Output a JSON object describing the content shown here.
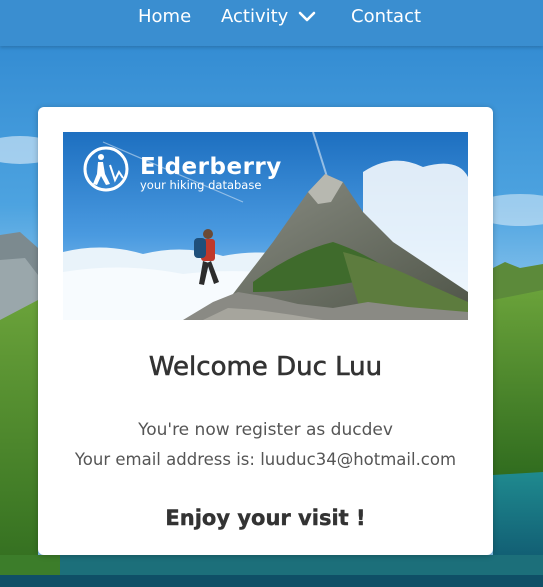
{
  "nav": {
    "home_label": "Home",
    "activity_label": "Activity",
    "contact_label": "Contact"
  },
  "card": {
    "logo": {
      "title": "Elderberry",
      "tagline": "your hiking database"
    },
    "welcome": "Welcome Duc Luu",
    "registered_line": "You're now register as ducdev",
    "email_line": "Your email address is: luuduc34@hotmail.com",
    "closing": "Enjoy your visit !"
  },
  "colors": {
    "navbar": "#3a8ed0",
    "nav_text": "#ffffff",
    "card_bg": "#ffffff",
    "heading_text": "#333333",
    "body_text": "#555555"
  },
  "icons": {
    "nav_dropdown": "chevron-down-icon",
    "logo": "hiker-logo-icon"
  }
}
